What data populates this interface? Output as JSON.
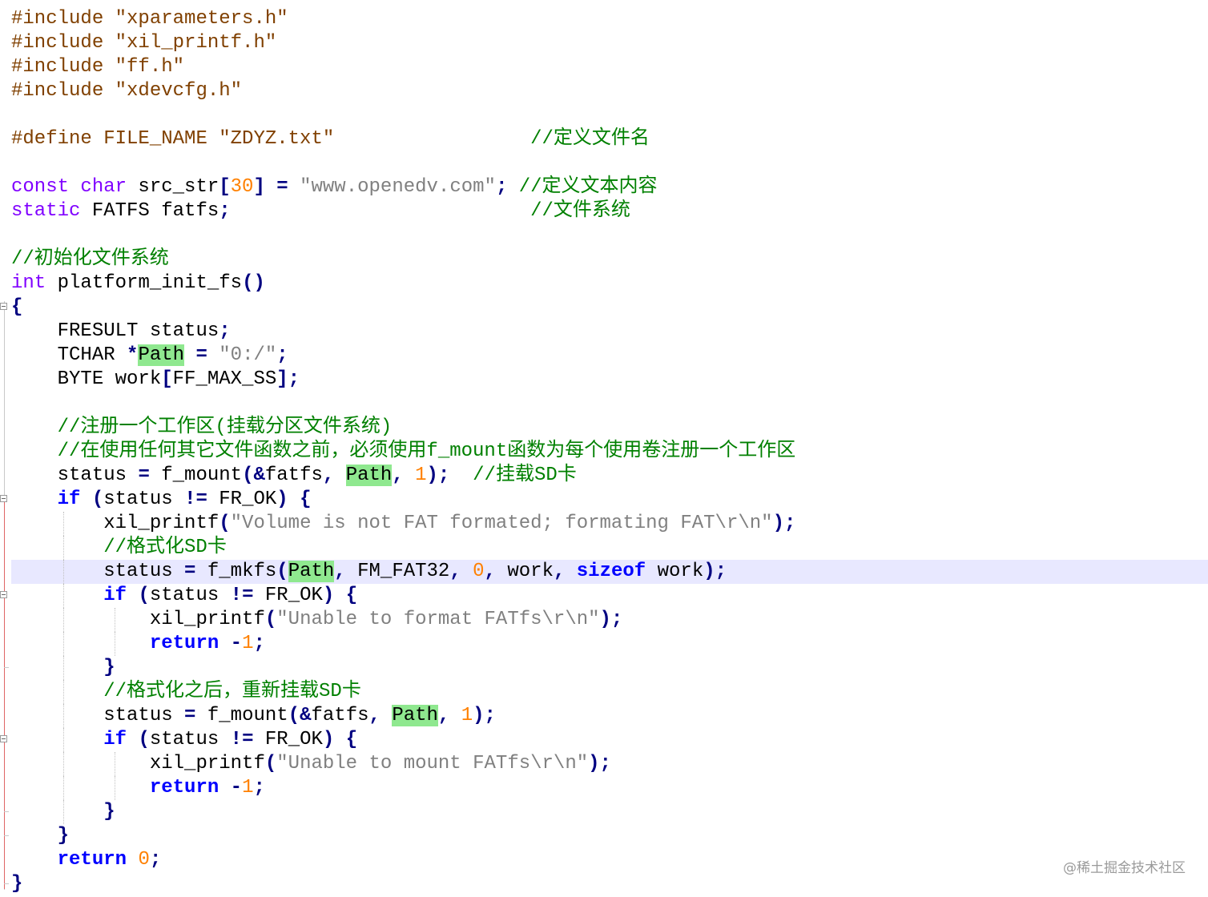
{
  "editor": {
    "lines": [
      {
        "segments": [
          {
            "t": "#include ",
            "c": "pp"
          },
          {
            "t": "\"xparameters.h\"",
            "c": "pp"
          }
        ]
      },
      {
        "segments": [
          {
            "t": "#include ",
            "c": "pp"
          },
          {
            "t": "\"xil_printf.h\"",
            "c": "pp"
          }
        ]
      },
      {
        "segments": [
          {
            "t": "#include ",
            "c": "pp"
          },
          {
            "t": "\"ff.h\"",
            "c": "pp"
          }
        ]
      },
      {
        "segments": [
          {
            "t": "#include ",
            "c": "pp"
          },
          {
            "t": "\"xdevcfg.h\"",
            "c": "pp"
          }
        ]
      },
      {
        "segments": []
      },
      {
        "segments": [
          {
            "t": "#define FILE_NAME \"ZDYZ.txt\"",
            "c": "pp"
          },
          {
            "t": "                 ",
            "c": ""
          },
          {
            "t": "//定义文件名",
            "c": "cmt"
          }
        ]
      },
      {
        "segments": []
      },
      {
        "segments": [
          {
            "t": "const",
            "c": "kw-type"
          },
          {
            "t": " ",
            "c": ""
          },
          {
            "t": "char",
            "c": "kw-type"
          },
          {
            "t": " src_str",
            "c": ""
          },
          {
            "t": "[",
            "c": "op"
          },
          {
            "t": "30",
            "c": "num"
          },
          {
            "t": "]",
            "c": "op"
          },
          {
            "t": " ",
            "c": ""
          },
          {
            "t": "=",
            "c": "op"
          },
          {
            "t": " ",
            "c": ""
          },
          {
            "t": "\"www.openedv.com\"",
            "c": "str"
          },
          {
            "t": ";",
            "c": "op"
          },
          {
            "t": " ",
            "c": ""
          },
          {
            "t": "//定义文本内容",
            "c": "cmt"
          }
        ]
      },
      {
        "segments": [
          {
            "t": "static",
            "c": "kw-type"
          },
          {
            "t": " FATFS fatfs",
            "c": ""
          },
          {
            "t": ";",
            "c": "op"
          },
          {
            "t": "                          ",
            "c": ""
          },
          {
            "t": "//文件系统",
            "c": "cmt"
          }
        ]
      },
      {
        "segments": []
      },
      {
        "segments": [
          {
            "t": "//初始化文件系统",
            "c": "cmt"
          }
        ]
      },
      {
        "segments": [
          {
            "t": "int",
            "c": "kw-type"
          },
          {
            "t": " platform_init_fs",
            "c": ""
          },
          {
            "t": "()",
            "c": "op"
          }
        ]
      },
      {
        "segments": [
          {
            "t": "{",
            "c": "op"
          }
        ]
      },
      {
        "segments": [
          {
            "t": "    FRESULT status",
            "c": ""
          },
          {
            "t": ";",
            "c": "op"
          }
        ],
        "guides": []
      },
      {
        "segments": [
          {
            "t": "    TCHAR ",
            "c": ""
          },
          {
            "t": "*",
            "c": "op"
          },
          {
            "t": "Path",
            "c": "hl"
          },
          {
            "t": " ",
            "c": ""
          },
          {
            "t": "=",
            "c": "op"
          },
          {
            "t": " ",
            "c": ""
          },
          {
            "t": "\"0:/\"",
            "c": "str"
          },
          {
            "t": ";",
            "c": "op"
          }
        ]
      },
      {
        "segments": [
          {
            "t": "    BYTE work",
            "c": ""
          },
          {
            "t": "[",
            "c": "op"
          },
          {
            "t": "FF_MAX_SS",
            "c": ""
          },
          {
            "t": "];",
            "c": "op"
          }
        ]
      },
      {
        "segments": []
      },
      {
        "segments": [
          {
            "t": "    ",
            "c": ""
          },
          {
            "t": "//注册一个工作区(挂载分区文件系统)",
            "c": "cmt"
          }
        ]
      },
      {
        "segments": [
          {
            "t": "    ",
            "c": ""
          },
          {
            "t": "//在使用任何其它文件函数之前，必须使用f_mount函数为每个使用卷注册一个工作区",
            "c": "cmt"
          }
        ]
      },
      {
        "segments": [
          {
            "t": "    status ",
            "c": ""
          },
          {
            "t": "=",
            "c": "op"
          },
          {
            "t": " f_mount",
            "c": ""
          },
          {
            "t": "(&",
            "c": "op"
          },
          {
            "t": "fatfs",
            "c": ""
          },
          {
            "t": ",",
            "c": "op"
          },
          {
            "t": " ",
            "c": ""
          },
          {
            "t": "Path",
            "c": "hl"
          },
          {
            "t": ",",
            "c": "op"
          },
          {
            "t": " ",
            "c": ""
          },
          {
            "t": "1",
            "c": "num"
          },
          {
            "t": ");",
            "c": "op"
          },
          {
            "t": "  ",
            "c": ""
          },
          {
            "t": "//挂载SD卡",
            "c": "cmt"
          }
        ]
      },
      {
        "segments": [
          {
            "t": "    ",
            "c": ""
          },
          {
            "t": "if",
            "c": "kw"
          },
          {
            "t": " ",
            "c": ""
          },
          {
            "t": "(",
            "c": "op"
          },
          {
            "t": "status ",
            "c": ""
          },
          {
            "t": "!=",
            "c": "op"
          },
          {
            "t": " FR_OK",
            "c": ""
          },
          {
            "t": ")",
            "c": "op"
          },
          {
            "t": " ",
            "c": ""
          },
          {
            "t": "{",
            "c": "op"
          }
        ]
      },
      {
        "segments": [
          {
            "t": "        xil_printf",
            "c": ""
          },
          {
            "t": "(",
            "c": "op"
          },
          {
            "t": "\"Volume is not FAT formated; formating FAT\\r\\n\"",
            "c": "str"
          },
          {
            "t": ");",
            "c": "op"
          }
        ],
        "guides": [
          4
        ]
      },
      {
        "segments": [
          {
            "t": "        ",
            "c": ""
          },
          {
            "t": "//格式化SD卡",
            "c": "cmt"
          }
        ],
        "guides": [
          4
        ]
      },
      {
        "segments": [
          {
            "t": "        status ",
            "c": ""
          },
          {
            "t": "=",
            "c": "op"
          },
          {
            "t": " f_mkfs",
            "c": ""
          },
          {
            "t": "(",
            "c": "op"
          },
          {
            "t": "Path",
            "c": "hl"
          },
          {
            "t": ",",
            "c": "op"
          },
          {
            "t": " FM_FAT32",
            "c": ""
          },
          {
            "t": ",",
            "c": "op"
          },
          {
            "t": " ",
            "c": ""
          },
          {
            "t": "0",
            "c": "num"
          },
          {
            "t": ",",
            "c": "op"
          },
          {
            "t": " work",
            "c": ""
          },
          {
            "t": ",",
            "c": "op"
          },
          {
            "t": " ",
            "c": ""
          },
          {
            "t": "sizeof",
            "c": "kw"
          },
          {
            "t": " work",
            "c": ""
          },
          {
            "t": ");",
            "c": "op"
          }
        ],
        "current": true,
        "guides": [
          4
        ]
      },
      {
        "segments": [
          {
            "t": "        ",
            "c": ""
          },
          {
            "t": "if",
            "c": "kw"
          },
          {
            "t": " ",
            "c": ""
          },
          {
            "t": "(",
            "c": "op"
          },
          {
            "t": "status ",
            "c": ""
          },
          {
            "t": "!=",
            "c": "op"
          },
          {
            "t": " FR_OK",
            "c": ""
          },
          {
            "t": ")",
            "c": "op"
          },
          {
            "t": " ",
            "c": ""
          },
          {
            "t": "{",
            "c": "op"
          }
        ],
        "guides": [
          4
        ]
      },
      {
        "segments": [
          {
            "t": "            xil_printf",
            "c": ""
          },
          {
            "t": "(",
            "c": "op"
          },
          {
            "t": "\"Unable to format FATfs\\r\\n\"",
            "c": "str"
          },
          {
            "t": ");",
            "c": "op"
          }
        ],
        "guides": [
          4,
          8
        ]
      },
      {
        "segments": [
          {
            "t": "            ",
            "c": ""
          },
          {
            "t": "return",
            "c": "kw"
          },
          {
            "t": " ",
            "c": ""
          },
          {
            "t": "-",
            "c": "op"
          },
          {
            "t": "1",
            "c": "num"
          },
          {
            "t": ";",
            "c": "op"
          }
        ],
        "guides": [
          4,
          8
        ]
      },
      {
        "segments": [
          {
            "t": "        ",
            "c": ""
          },
          {
            "t": "}",
            "c": "op"
          }
        ],
        "guides": [
          4
        ]
      },
      {
        "segments": [
          {
            "t": "        ",
            "c": ""
          },
          {
            "t": "//格式化之后，重新挂载SD卡",
            "c": "cmt"
          }
        ],
        "guides": [
          4
        ]
      },
      {
        "segments": [
          {
            "t": "        status ",
            "c": ""
          },
          {
            "t": "=",
            "c": "op"
          },
          {
            "t": " f_mount",
            "c": ""
          },
          {
            "t": "(&",
            "c": "op"
          },
          {
            "t": "fatfs",
            "c": ""
          },
          {
            "t": ",",
            "c": "op"
          },
          {
            "t": " ",
            "c": ""
          },
          {
            "t": "Path",
            "c": "hl"
          },
          {
            "t": ",",
            "c": "op"
          },
          {
            "t": " ",
            "c": ""
          },
          {
            "t": "1",
            "c": "num"
          },
          {
            "t": ");",
            "c": "op"
          }
        ],
        "guides": [
          4
        ]
      },
      {
        "segments": [
          {
            "t": "        ",
            "c": ""
          },
          {
            "t": "if",
            "c": "kw"
          },
          {
            "t": " ",
            "c": ""
          },
          {
            "t": "(",
            "c": "op"
          },
          {
            "t": "status ",
            "c": ""
          },
          {
            "t": "!=",
            "c": "op"
          },
          {
            "t": " FR_OK",
            "c": ""
          },
          {
            "t": ")",
            "c": "op"
          },
          {
            "t": " ",
            "c": ""
          },
          {
            "t": "{",
            "c": "op"
          }
        ],
        "guides": [
          4
        ]
      },
      {
        "segments": [
          {
            "t": "            xil_printf",
            "c": ""
          },
          {
            "t": "(",
            "c": "op"
          },
          {
            "t": "\"Unable to mount FATfs\\r\\n\"",
            "c": "str"
          },
          {
            "t": ");",
            "c": "op"
          }
        ],
        "guides": [
          4,
          8
        ]
      },
      {
        "segments": [
          {
            "t": "            ",
            "c": ""
          },
          {
            "t": "return",
            "c": "kw"
          },
          {
            "t": " ",
            "c": ""
          },
          {
            "t": "-",
            "c": "op"
          },
          {
            "t": "1",
            "c": "num"
          },
          {
            "t": ";",
            "c": "op"
          }
        ],
        "guides": [
          4,
          8
        ]
      },
      {
        "segments": [
          {
            "t": "        ",
            "c": ""
          },
          {
            "t": "}",
            "c": "op"
          }
        ],
        "guides": [
          4
        ]
      },
      {
        "segments": [
          {
            "t": "    ",
            "c": ""
          },
          {
            "t": "}",
            "c": "op"
          }
        ]
      },
      {
        "segments": [
          {
            "t": "    ",
            "c": ""
          },
          {
            "t": "return",
            "c": "kw"
          },
          {
            "t": " ",
            "c": ""
          },
          {
            "t": "0",
            "c": "num"
          },
          {
            "t": ";",
            "c": "op"
          }
        ]
      },
      {
        "segments": [
          {
            "t": "}",
            "c": "op"
          }
        ]
      }
    ]
  },
  "watermark": "@稀土掘金技术社区",
  "colors": {
    "preprocessor": "#804000",
    "string": "#808080",
    "comment": "#008000",
    "type_keyword": "#8000ff",
    "keyword": "#0000ff",
    "number": "#ff8000",
    "operator": "#000080",
    "highlight": "#8fe88f",
    "current_line": "#e8e8ff"
  }
}
